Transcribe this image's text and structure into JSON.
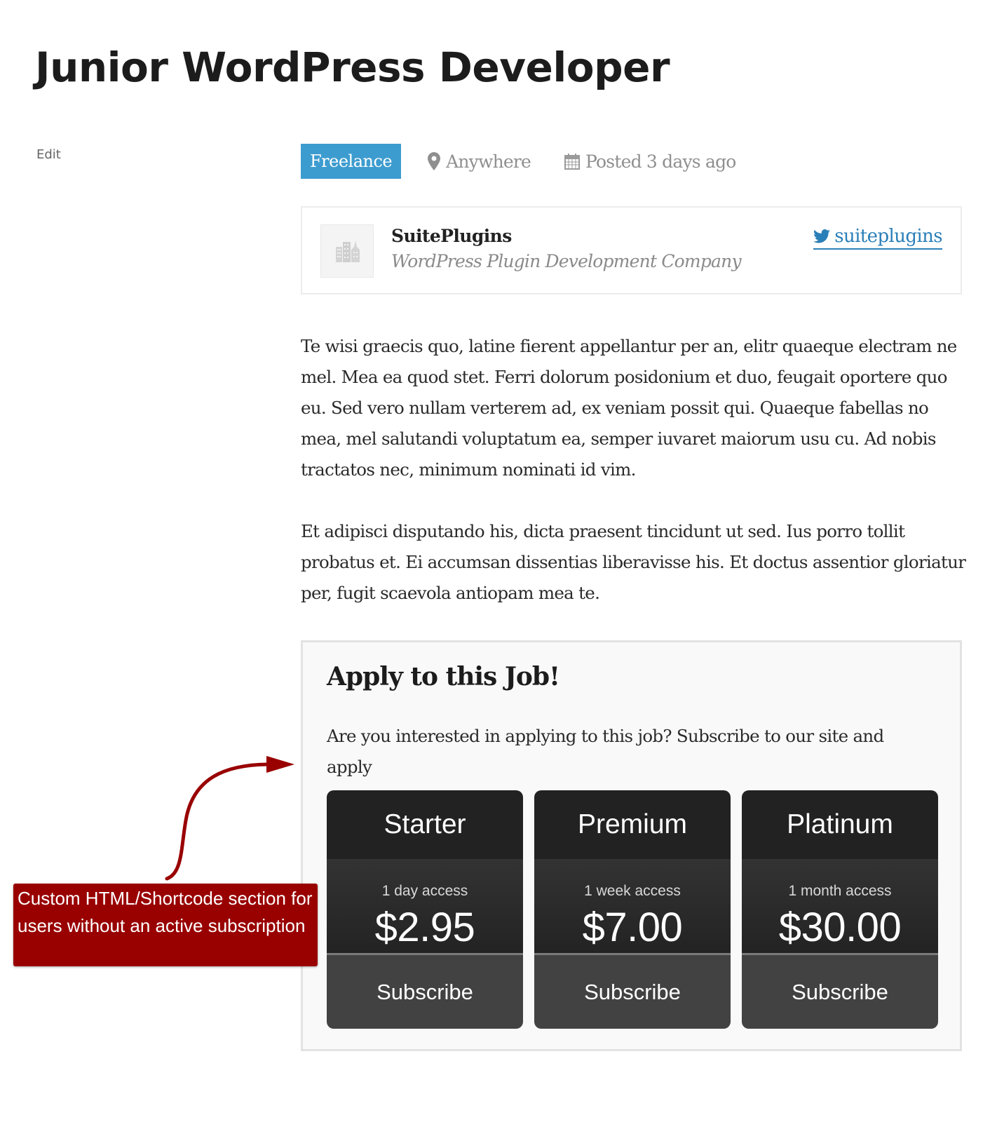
{
  "page": {
    "title": "Junior WordPress Developer",
    "edit_label": "Edit"
  },
  "meta": {
    "job_type": "Freelance",
    "job_type_color": "#3d9ccf",
    "location_icon": "map-pin-icon",
    "location": "Anywhere",
    "date_icon": "calendar-icon",
    "posted": "Posted 3 days ago"
  },
  "company": {
    "logo_icon": "building-icon",
    "name": "SuitePlugins",
    "tagline": "WordPress Plugin Development Company",
    "twitter_icon": "twitter-bird-icon",
    "twitter_handle": "suiteplugins",
    "link_color": "#2b7fb8"
  },
  "description": {
    "paragraphs": [
      "Te wisi graecis quo, latine fierent appellantur per an, elitr quaeque electram ne mel. Mea ea quod stet. Ferri dolorum posidonium et duo, feugait oportere quo eu. Sed vero nullam verterem ad, ex veniam possit qui. Quaeque fabellas no mea, mel salutandi voluptatum ea, semper iuvaret maiorum usu cu. Ad nobis tractatos nec, minimum nominati id vim.",
      "Et adipisci disputando his, dicta praesent tincidunt ut sed. Ius porro tollit probatus et. Ei accumsan dissentias liberavisse his. Et doctus assentior gloriatur per, fugit scaevola antiopam mea te."
    ]
  },
  "apply": {
    "title": "Apply to this Job!",
    "text": "Are you interested in applying to this job? Subscribe to our site and apply",
    "plans": [
      {
        "name": "Starter",
        "duration": "1 day access",
        "price": "$2.95",
        "button": "Subscribe"
      },
      {
        "name": "Premium",
        "duration": "1 week access",
        "price": "$7.00",
        "button": "Subscribe"
      },
      {
        "name": "Platinum",
        "duration": "1 month access",
        "price": "$30.00",
        "button": "Subscribe"
      }
    ]
  },
  "annotation": {
    "text": "Custom HTML/Shortcode section for users without an active subscription",
    "color": "#990000"
  }
}
